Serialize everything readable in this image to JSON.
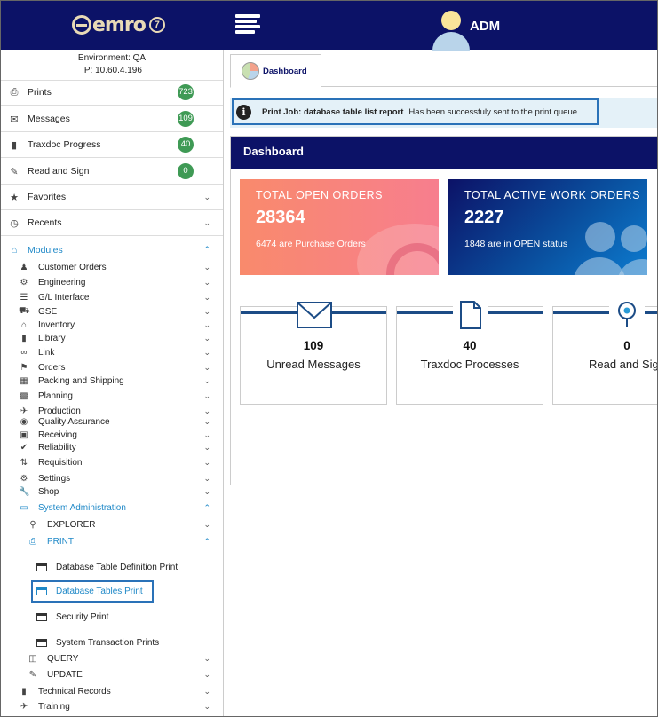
{
  "header": {
    "logo_text": "emro",
    "logo_version": "7",
    "user_name": "ADM"
  },
  "sidebar": {
    "environment": "Environment: QA",
    "ip": "IP: 10.60.4.196",
    "top_items": [
      {
        "label": "Prints",
        "icon": "printer-icon",
        "badge": "723"
      },
      {
        "label": "Messages",
        "icon": "envelope-icon",
        "badge": "109"
      },
      {
        "label": "Traxdoc Progress",
        "icon": "book-icon",
        "badge": "40"
      },
      {
        "label": "Read and Sign",
        "icon": "pencil-icon",
        "badge": "0"
      },
      {
        "label": "Favorites",
        "icon": "star-icon"
      },
      {
        "label": "Recents",
        "icon": "clock-icon"
      }
    ],
    "modules_label": "Modules",
    "modules": [
      {
        "label": "Customer Orders",
        "icon": "users-icon"
      },
      {
        "label": "Engineering",
        "icon": "gear-icon"
      },
      {
        "label": "G/L Interface",
        "icon": "list-icon"
      },
      {
        "label": "GSE",
        "icon": "truck-icon"
      },
      {
        "label": "Inventory",
        "icon": "home-icon"
      },
      {
        "label": "Library",
        "icon": "book-icon"
      },
      {
        "label": "Link",
        "icon": "link-icon"
      },
      {
        "label": "Orders",
        "icon": "tag-icon"
      },
      {
        "label": "Packing and Shipping",
        "icon": "box-icon"
      },
      {
        "label": "Planning",
        "icon": "calendar-icon"
      },
      {
        "label": "Production",
        "icon": "plane-icon"
      },
      {
        "label": "Quality Assurance",
        "icon": "eye-icon"
      },
      {
        "label": "Receiving",
        "icon": "folder-icon"
      },
      {
        "label": "Reliability",
        "icon": "check-circle-icon"
      },
      {
        "label": "Requisition",
        "icon": "sort-icon"
      },
      {
        "label": "Settings",
        "icon": "cogs-icon"
      },
      {
        "label": "Shop",
        "icon": "wrench-icon"
      },
      {
        "label": "System Administration",
        "icon": "monitor-icon"
      }
    ],
    "sysadmin_children": {
      "explorer": "EXPLORER",
      "print": "PRINT",
      "print_items": [
        "Database Table Definition Print",
        "Database Tables Print",
        "Security Print",
        "System Transaction Prints"
      ],
      "query": "QUERY",
      "update": "UPDATE"
    },
    "bottom_modules": [
      {
        "label": "Technical Records",
        "icon": "book-icon"
      },
      {
        "label": "Training",
        "icon": "plane-icon"
      }
    ]
  },
  "tabs": [
    {
      "label": "Dashboard",
      "icon": "pie-chart-icon"
    }
  ],
  "notice": {
    "title": "Print Job: database table list report",
    "message": "Has been successfuly sent to the print queue"
  },
  "dashboard": {
    "title": "Dashboard",
    "cards": [
      {
        "label": "TOTAL OPEN ORDERS",
        "value": "28364",
        "desc": "6474 are Purchase Orders"
      },
      {
        "label": "TOTAL ACTIVE WORK ORDERS",
        "value": "2227",
        "desc": "1848 are in OPEN status"
      }
    ],
    "tiles": [
      {
        "count": "109",
        "label": "Unread Messages",
        "icon": "envelope-icon"
      },
      {
        "count": "40",
        "label": "Traxdoc Processes",
        "icon": "document-icon"
      },
      {
        "count": "0",
        "label": "Read and Sign",
        "icon": "pin-icon"
      }
    ]
  },
  "colors": {
    "navy": "#0c1267",
    "accent_blue": "#1e88c7",
    "badge_green": "#3f9a55",
    "highlight_border": "#2a72b8"
  }
}
